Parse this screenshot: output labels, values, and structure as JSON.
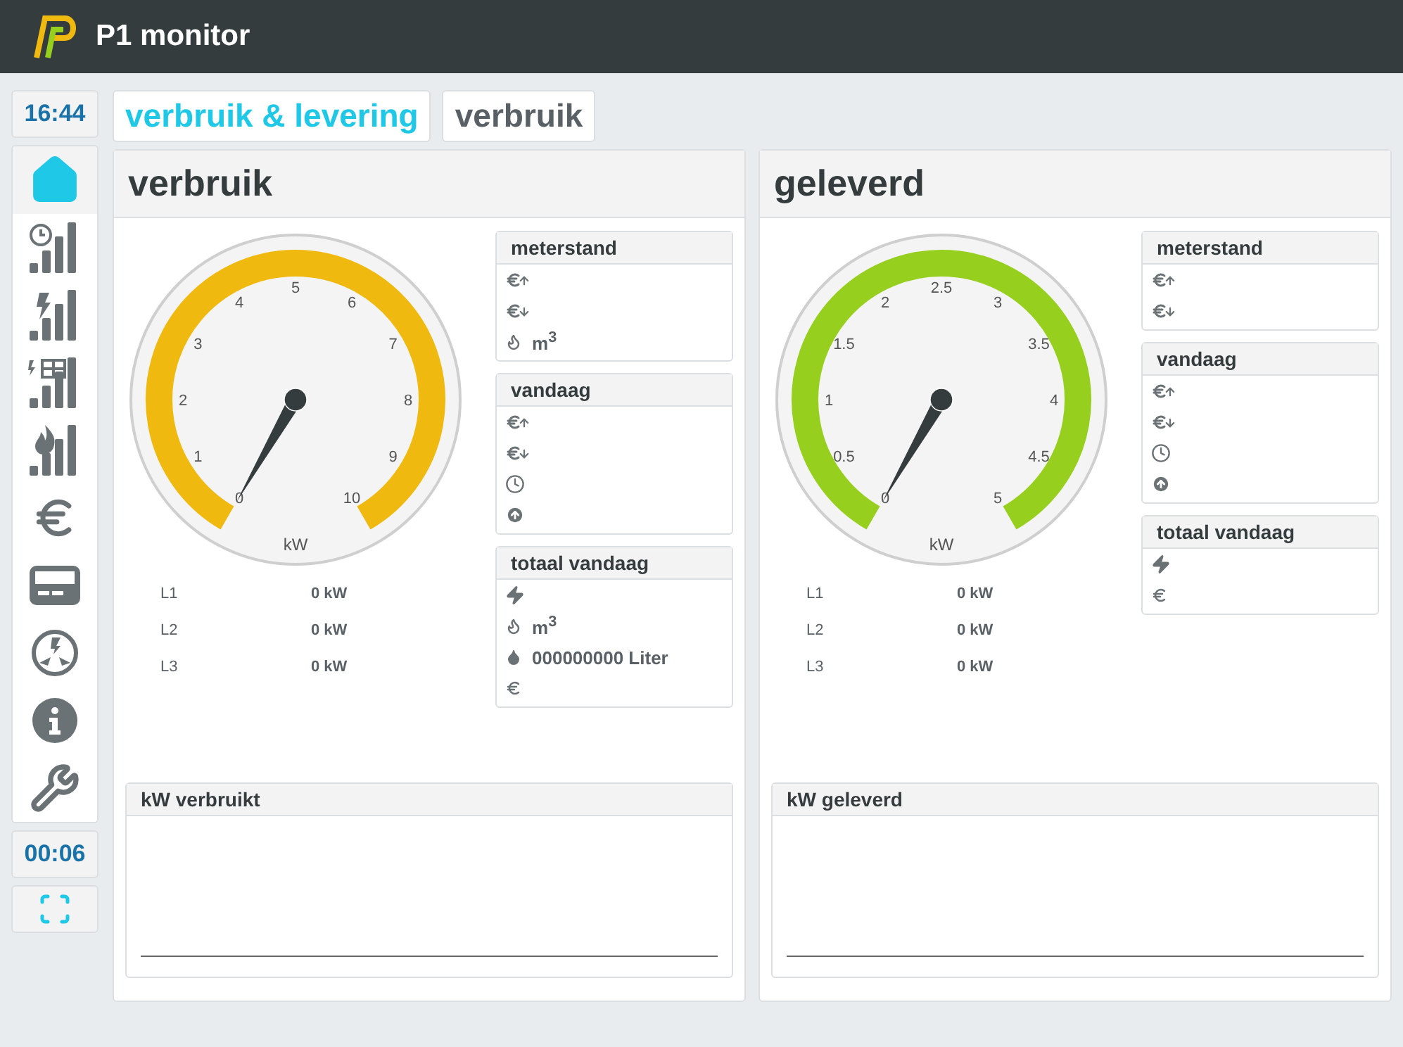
{
  "app": {
    "title": "P1 monitor"
  },
  "sidebar": {
    "time": "16:44",
    "timer": "00:06",
    "items": [
      {
        "kind": "home",
        "selected": true
      },
      {
        "kind": "clock-bars",
        "selected": false
      },
      {
        "kind": "bolt-bars",
        "selected": false
      },
      {
        "kind": "solar-bars",
        "selected": false
      },
      {
        "kind": "flame-bars",
        "selected": false
      },
      {
        "kind": "euro",
        "selected": false
      },
      {
        "kind": "card",
        "selected": false
      },
      {
        "kind": "phases",
        "selected": false
      },
      {
        "kind": "info",
        "selected": false
      },
      {
        "kind": "wrench",
        "selected": false
      }
    ]
  },
  "tabs": [
    {
      "label": "verbruik & levering",
      "selected": true
    },
    {
      "label": "verbruik",
      "selected": false
    }
  ],
  "panels": [
    {
      "title": "verbruik",
      "gauge": {
        "color": "#f0b90f",
        "unit": "kW",
        "ticks": [
          "0",
          "1",
          "2",
          "3",
          "4",
          "5",
          "6",
          "7",
          "8",
          "9",
          "10"
        ]
      },
      "phases": [
        {
          "label": "L1",
          "value": "0 kW"
        },
        {
          "label": "L2",
          "value": "0 kW"
        },
        {
          "label": "L3",
          "value": "0 kW"
        }
      ],
      "cards": [
        {
          "title": "meterstand",
          "rows": [
            {
              "kind": "euro-up"
            },
            {
              "kind": "euro-down"
            },
            {
              "kind": "flame",
              "text": "m$^{3}$"
            }
          ]
        },
        {
          "title": "vandaag",
          "rows": [
            {
              "kind": "euro-up"
            },
            {
              "kind": "euro-down"
            },
            {
              "kind": "clock"
            },
            {
              "kind": "arrow-up"
            }
          ]
        },
        {
          "title": "totaal vandaag",
          "rows": [
            {
              "kind": "bolt"
            },
            {
              "kind": "flame",
              "text": "m$^{3}$"
            },
            {
              "kind": "drop",
              "text": "000000000 Liter"
            },
            {
              "kind": "euro"
            }
          ]
        }
      ],
      "chart_title": "kW verbruikt"
    },
    {
      "title": "geleverd",
      "gauge": {
        "color": "#97cf1f",
        "unit": "kW",
        "ticks": [
          "0",
          "0.5",
          "1",
          "1.5",
          "2",
          "2.5",
          "3",
          "3.5",
          "4",
          "4.5",
          "5"
        ]
      },
      "phases": [
        {
          "label": "L1",
          "value": "0 kW"
        },
        {
          "label": "L2",
          "value": "0 kW"
        },
        {
          "label": "L3",
          "value": "0 kW"
        }
      ],
      "cards": [
        {
          "title": "meterstand",
          "rows": [
            {
              "kind": "euro-up"
            },
            {
              "kind": "euro-down"
            }
          ]
        },
        {
          "title": "vandaag",
          "rows": [
            {
              "kind": "euro-up"
            },
            {
              "kind": "euro-down"
            },
            {
              "kind": "clock"
            },
            {
              "kind": "arrow-up"
            }
          ]
        },
        {
          "title": "totaal vandaag",
          "rows": [
            {
              "kind": "bolt"
            },
            {
              "kind": "euro"
            }
          ]
        }
      ],
      "chart_title": "kW geleverd"
    }
  ]
}
